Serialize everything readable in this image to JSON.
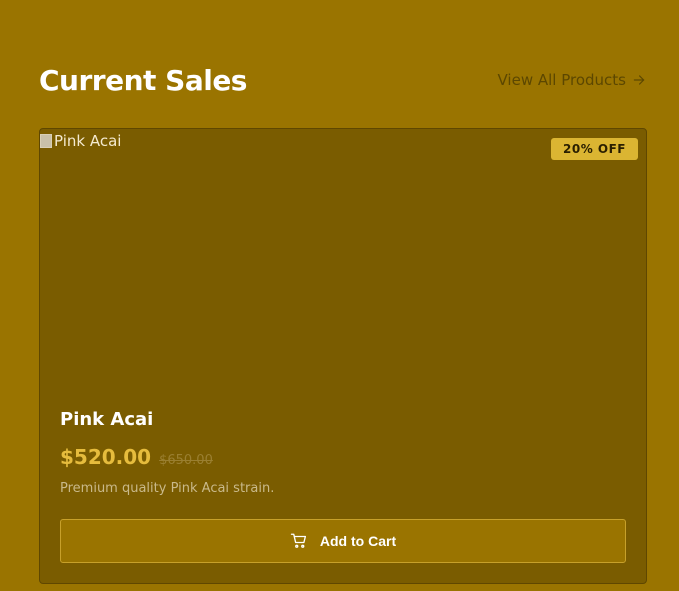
{
  "section": {
    "title": "Current Sales",
    "view_all_label": "View All Products",
    "view_all_icon": "arrow-right-icon"
  },
  "product": {
    "image_alt": "Pink Acai",
    "badge": "20% OFF",
    "name": "Pink Acai",
    "price": "$520.00",
    "original_price": "$650.00",
    "description": "Premium quality Pink Acai strain.",
    "add_to_cart_label": "Add to Cart",
    "cart_icon": "cart-icon"
  },
  "colors": {
    "background": "#9a7400",
    "card": "#7a5c00",
    "accent": "#e6bc3d",
    "badge": "#dbb532"
  }
}
